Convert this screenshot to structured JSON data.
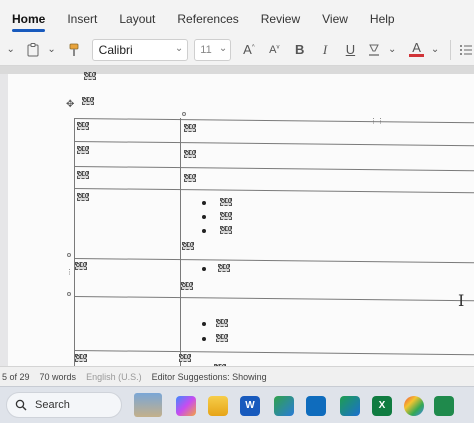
{
  "ribbon": {
    "tabs": [
      "Home",
      "Insert",
      "Layout",
      "References",
      "Review",
      "View",
      "Help"
    ],
    "active_tab": "Home",
    "font_name": "Calibri",
    "font_size": "11",
    "format_buttons": {
      "grow_font": "A",
      "shrink_font": "A",
      "bold": "B",
      "italic": "I",
      "underline": "U",
      "font_color": "A"
    }
  },
  "document": {
    "placeholder_text": "OLU"
  },
  "statusbar": {
    "page": "5 of 29",
    "words": "70 words",
    "language": "English (U.S.)",
    "suggestions": "Editor Suggestions: Showing"
  },
  "taskbar": {
    "search_label": "Search",
    "accent": "#185abd"
  }
}
